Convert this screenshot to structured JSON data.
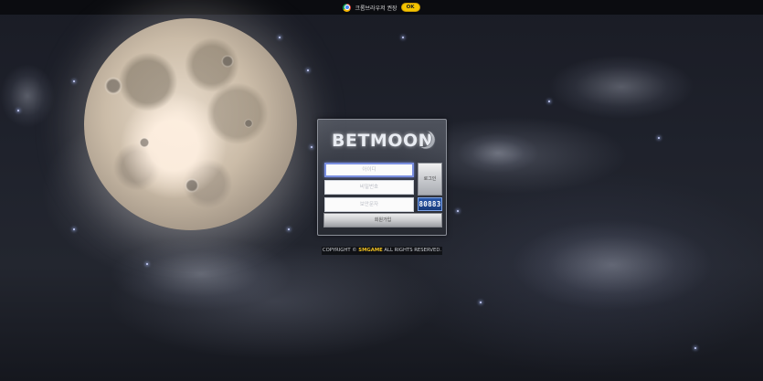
{
  "topbar": {
    "notice_text": "크롬브라우저 권장",
    "ok_label": "OK"
  },
  "logo": {
    "text": "BETMOON"
  },
  "login_form": {
    "id_placeholder": "아이디",
    "password_placeholder": "비밀번호",
    "captcha_placeholder": "보안문자",
    "login_label": "로그인",
    "captcha_code": "80883",
    "signup_label": "회원가입"
  },
  "footer": {
    "copyright_prefix": "COPYRIGHT © ",
    "copyright_brand": "SMGAME",
    "copyright_suffix": " ALL RIGHTS RESERVED."
  },
  "colors": {
    "ok_button": "#f4c400",
    "captcha_bg": "#2b58a8",
    "copyright_brand": "#f0c020"
  }
}
